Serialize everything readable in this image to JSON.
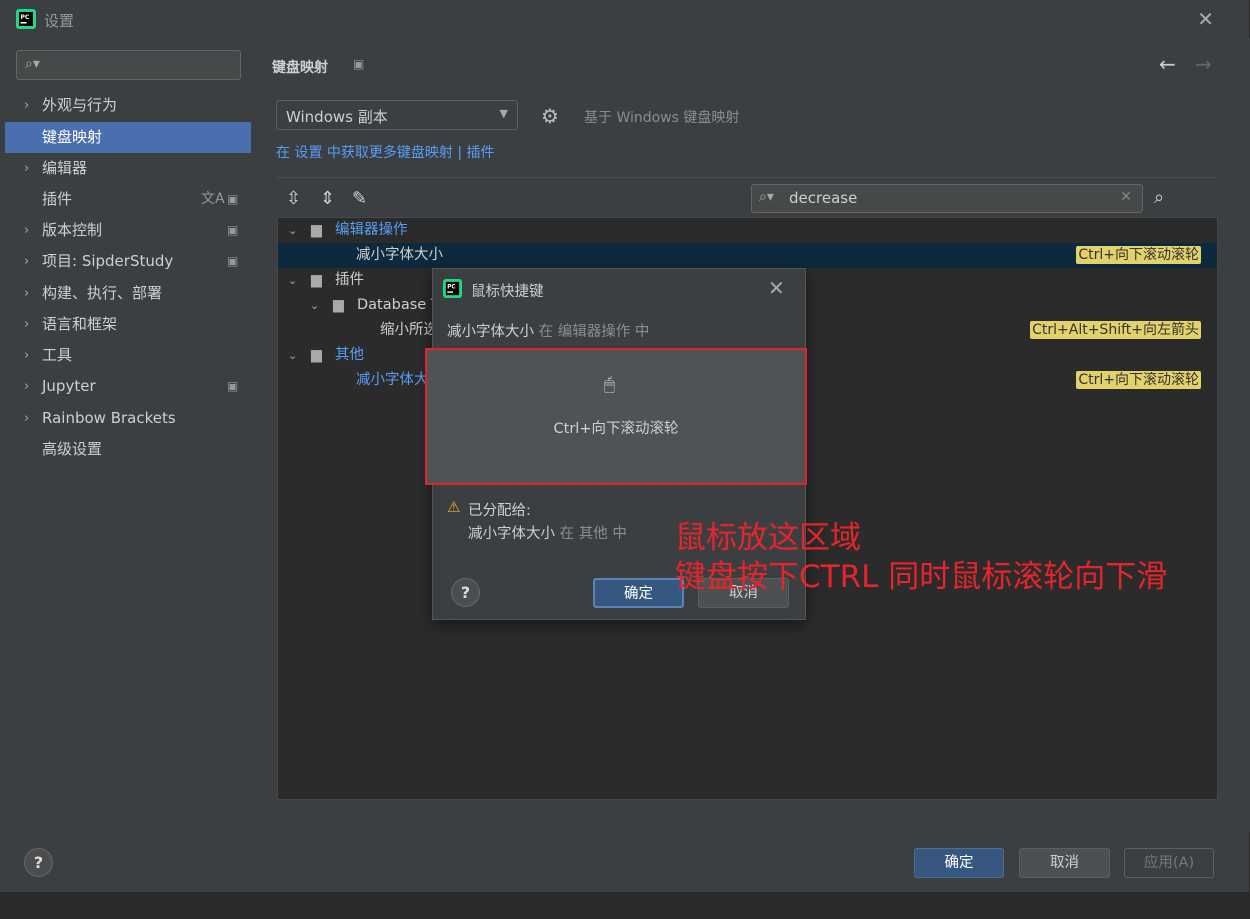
{
  "window": {
    "title": "设置",
    "close_glyph": "✕"
  },
  "sidebar": {
    "search_placeholder": "",
    "items": [
      {
        "label": "外观与行为",
        "expandable": true
      },
      {
        "label": "键盘映射",
        "expandable": false,
        "selected": true
      },
      {
        "label": "编辑器",
        "expandable": true
      },
      {
        "label": "插件",
        "expandable": false,
        "icons": [
          "translate-icon",
          "project-scope-icon"
        ]
      },
      {
        "label": "版本控制",
        "expandable": true,
        "icons": [
          "project-scope-icon"
        ]
      },
      {
        "label": "项目: SipderStudy",
        "expandable": true,
        "icons": [
          "project-scope-icon"
        ]
      },
      {
        "label": "构建、执行、部署",
        "expandable": true
      },
      {
        "label": "语言和框架",
        "expandable": true
      },
      {
        "label": "工具",
        "expandable": true
      },
      {
        "label": "Jupyter",
        "expandable": true,
        "icons": [
          "project-scope-icon"
        ]
      },
      {
        "label": "Rainbow Brackets",
        "expandable": true
      },
      {
        "label": "高级设置",
        "expandable": false
      }
    ]
  },
  "main": {
    "title": "键盘映射",
    "keymap_value": "Windows 副本",
    "based_on": "基于 Windows 键盘映射",
    "more_link": "在 设置 中获取更多键盘映射 | 插件",
    "search_value": "decrease",
    "tree": [
      {
        "label": "编辑器操作",
        "kind": "group",
        "color": "blue"
      },
      {
        "label": "减小字体大小",
        "kind": "action",
        "shortcut": "Ctrl+向下滚动滚轮",
        "selected": true
      },
      {
        "label": "插件",
        "kind": "group"
      },
      {
        "label": "Database T",
        "kind": "subgroup"
      },
      {
        "label": "缩小所选",
        "kind": "action",
        "shortcut": "Ctrl+Alt+Shift+向左箭头"
      },
      {
        "label": "其他",
        "kind": "group",
        "color": "blue"
      },
      {
        "label": "减小字体大小",
        "kind": "action",
        "color": "blue",
        "shortcut": "Ctrl+向下滚动滚轮"
      }
    ]
  },
  "footer": {
    "ok": "确定",
    "cancel": "取消",
    "apply": "应用(A)",
    "help": "?"
  },
  "dialog": {
    "title": "鼠标快捷键",
    "action": "减小字体大小",
    "in_word": "在",
    "group": "编辑器操作",
    "mid_word": "中",
    "mouse_shortcut": "Ctrl+向下滚动滚轮",
    "warning_title": "已分配给:",
    "conflict_action": "减小字体大小",
    "conflict_in": "在",
    "conflict_group": "其他",
    "conflict_mid": "中",
    "ok": "确定",
    "cancel": "取消",
    "help": "?"
  },
  "annotation": {
    "line1": "鼠标放这区域",
    "line2": "键盘按下CTRL  同时鼠标滚轮向下滑",
    "color": "#e5242b"
  },
  "colors": {
    "accent": "#4b6eaf",
    "highlight": "#e3d16a",
    "link": "#589df6"
  }
}
